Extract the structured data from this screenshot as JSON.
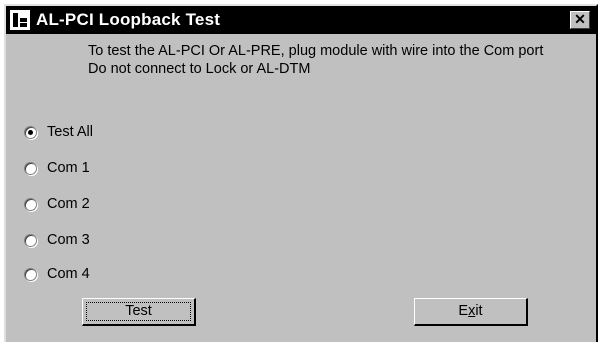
{
  "window": {
    "title": "AL-PCI Loopback Test",
    "close_label": "✕"
  },
  "instructions": "To test the AL-PCI Or AL-PRE, plug module with wire into the Com port Do not connect to Lock or AL-DTM",
  "options": [
    {
      "label": "Test All",
      "selected": true
    },
    {
      "label": "Com 1",
      "selected": false
    },
    {
      "label": "Com 2",
      "selected": false
    },
    {
      "label": "Com 3",
      "selected": false
    },
    {
      "label": "Com 4",
      "selected": false
    }
  ],
  "buttons": {
    "test_label": "Test",
    "exit_prefix": "E",
    "exit_accel": "x",
    "exit_suffix": "it"
  }
}
